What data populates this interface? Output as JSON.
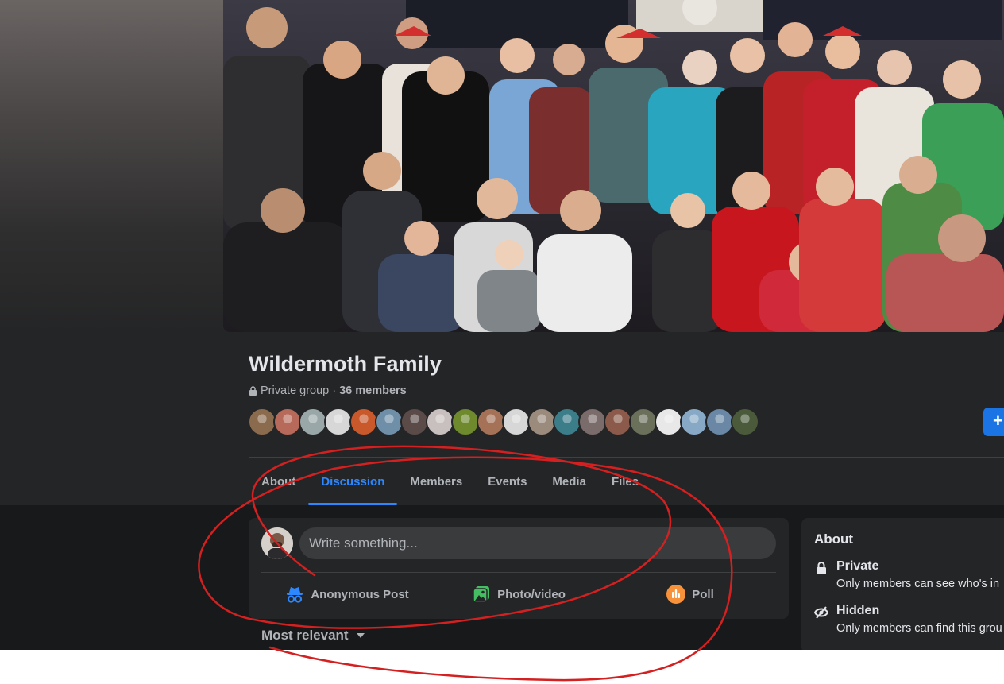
{
  "group": {
    "name": "Wildermoth Family",
    "privacy": "Private group",
    "separator": "·",
    "members": "36 members"
  },
  "tabs": [
    "About",
    "Discussion",
    "Members",
    "Events",
    "Media",
    "Files"
  ],
  "active_tab": "Discussion",
  "composer": {
    "placeholder": "Write something...",
    "actions": [
      {
        "label": "Anonymous Post",
        "icon": "anonymous-icon",
        "color": "#2d88ff"
      },
      {
        "label": "Photo/video",
        "icon": "photo-icon",
        "color": "#45bd62"
      },
      {
        "label": "Poll",
        "icon": "poll-icon",
        "color": "#f7b928"
      }
    ]
  },
  "sort": {
    "label": "Most relevant"
  },
  "about": {
    "title": "About",
    "private": {
      "title": "Private",
      "desc": "Only members can see who's in"
    },
    "hidden": {
      "title": "Hidden",
      "desc": "Only members can find this grou"
    }
  },
  "add_button": {
    "label": "+"
  },
  "member_avatar_colors": [
    "#8a6b4e",
    "#b86a5a",
    "#9aa7a8",
    "#d7d7d7",
    "#c9582a",
    "#6f8fa8",
    "#5a4b48",
    "#c8c0be",
    "#6e8a2c",
    "#a57257",
    "#d7d7d7",
    "#9a8b7c",
    "#3c7d8a",
    "#7a6c6a",
    "#8b5a4a",
    "#6a705a",
    "#e8e8e8",
    "#87a9c6",
    "#6a88a6",
    "#4a5a3a"
  ],
  "colors": {
    "accent": "#2d88ff",
    "annotation": "#d42020"
  }
}
